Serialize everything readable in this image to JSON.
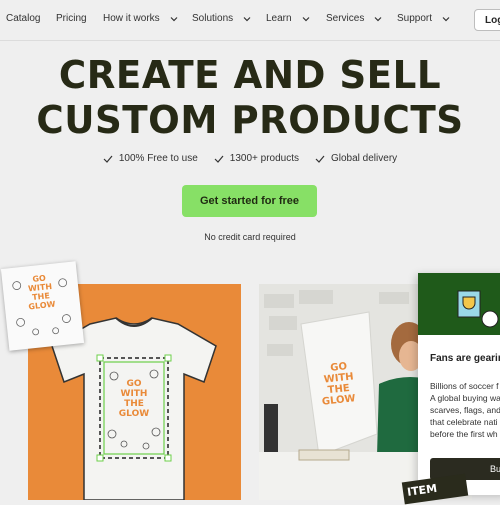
{
  "nav": {
    "items": [
      {
        "label": "Catalog",
        "dropdown": false
      },
      {
        "label": "Pricing",
        "dropdown": false
      },
      {
        "label": "How it works",
        "dropdown": true
      },
      {
        "label": "Solutions",
        "dropdown": true
      },
      {
        "label": "Learn",
        "dropdown": true
      },
      {
        "label": "Services",
        "dropdown": true
      },
      {
        "label": "Support",
        "dropdown": true
      }
    ],
    "login_label": "Log"
  },
  "hero": {
    "title_line1": "CREATE AND SELL",
    "title_line2": "CUSTOM PRODUCTS",
    "features": [
      "100% Free to use",
      "1300+ products",
      "Global delivery"
    ],
    "cta_label": "Get started for free",
    "note": "No credit card required"
  },
  "design_text": [
    "GO",
    "WITH",
    "THE",
    "GLOW"
  ],
  "popup": {
    "title": "Fans are gearing",
    "body_lines": [
      "Billions of soccer f",
      "A global buying wa",
      "scarves, flags, and",
      "that celebrate nati",
      "before the first wh"
    ],
    "button_label": "Bu"
  },
  "badge_text": "ITEM",
  "colors": {
    "accent_green": "#87e066",
    "orange": "#e98a39",
    "title_dark": "#272a16",
    "banner_green": "#1f5a1a"
  }
}
